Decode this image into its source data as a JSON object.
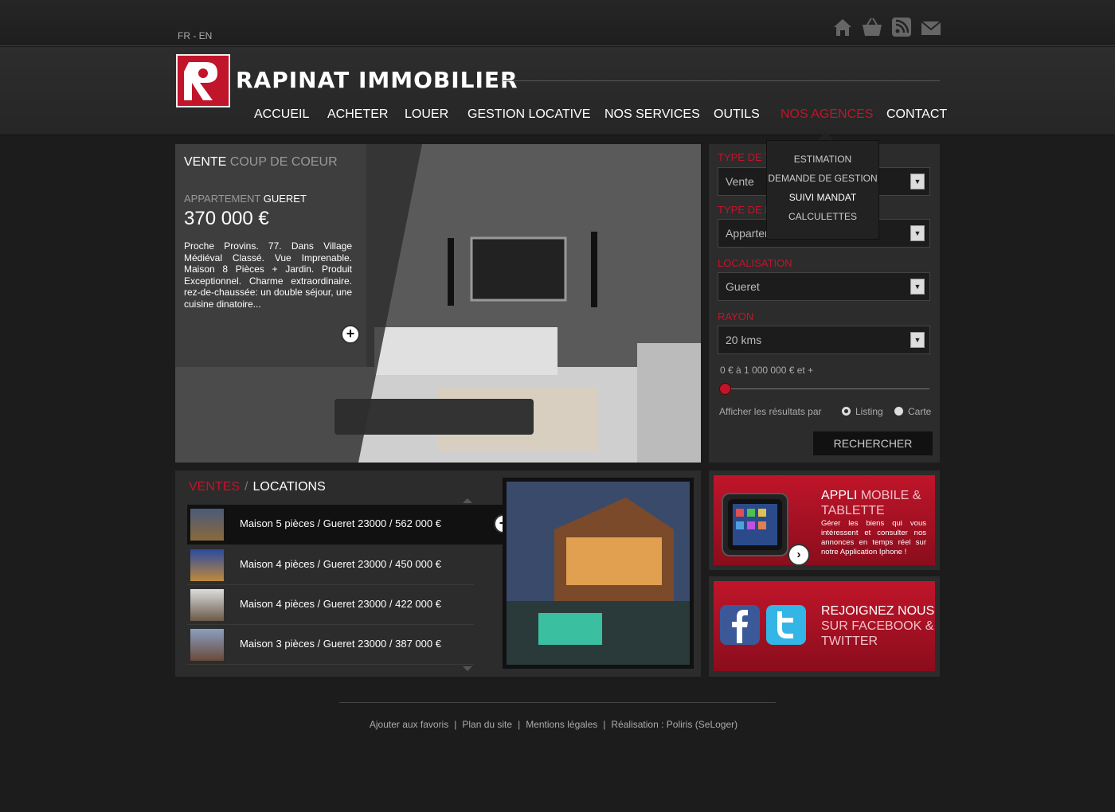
{
  "lang_switch": "FR - EN",
  "icons": [
    "home-icon",
    "basket-icon",
    "rss-icon",
    "mail-icon"
  ],
  "brand": {
    "name": "RAPINAT IMMOBILIER",
    "accent": "#c0152a"
  },
  "nav": {
    "items": [
      "ACCUEIL",
      "ACHETER",
      "LOUER",
      "GESTION LOCATIVE",
      "NOS SERVICES",
      "OUTILS",
      "NOS AGENCES",
      "CONTACT"
    ],
    "active": "NOS AGENCES",
    "dropdown": [
      "ESTIMATION",
      "DEMANDE DE GESTION",
      "SUIVI MANDAT",
      "CALCULETTES"
    ]
  },
  "hero": {
    "label": "VENTE",
    "label_sub": "COUP DE COEUR",
    "type": "APPARTEMENT",
    "city": "GUERET",
    "price": "370 000 €",
    "description": "Proche Provins. 77. Dans Village Médiéval Classé. Vue Imprenable. Maison 8 Pièces + Jardin. Produit Exceptionnel. Charme extraordinaire. rez-de-chaussée: un double séjour, une cuisine dinatoire..."
  },
  "search": {
    "type_transaction_label": "TYPE DE T",
    "type_transaction_value": "Vente",
    "type_bien_label": "TYPE DE B",
    "type_bien_value": "Appartement",
    "localisation_label": "LOCALISATION",
    "localisation_value": "Gueret",
    "rayon_label": "RAYON",
    "rayon_value": "20 kms",
    "range_text": "0 € à 1 000 000 € et +",
    "range_value": 0,
    "display_label": "Afficher les résultats par",
    "display_options": [
      "Listing",
      "Carte"
    ],
    "display_selected": "Listing",
    "submit": "RECHERCHER"
  },
  "listings": {
    "tab_active": "VENTES",
    "tab_separator": "/",
    "tab_other": "LOCATIONS",
    "items": [
      "Maison 5 pièces / Gueret 23000 / 562 000 €",
      "Maison 4 pièces / Gueret 23000 / 450 000 €",
      "Maison 4 pièces / Gueret 23000 / 422 000 €",
      "Maison 3 pièces / Gueret 23000 / 387 000 €"
    ]
  },
  "promo_app": {
    "title_white": "APPLI",
    "title_pink": "MOBILE & TABLETTE",
    "desc": "Gérer les biens qui vous intéressent et consulter nos annonces en temps réel sur notre Application Iphone !"
  },
  "promo_social": {
    "line1": "REJOIGNEZ NOUS",
    "line2": "SUR FACEBOOK &",
    "line3": "TWITTER"
  },
  "footer": {
    "links": [
      "Ajouter aux favoris",
      "Plan du site",
      "Mentions légales",
      "Réalisation : Poliris (SeLoger)"
    ],
    "separator": "|"
  }
}
